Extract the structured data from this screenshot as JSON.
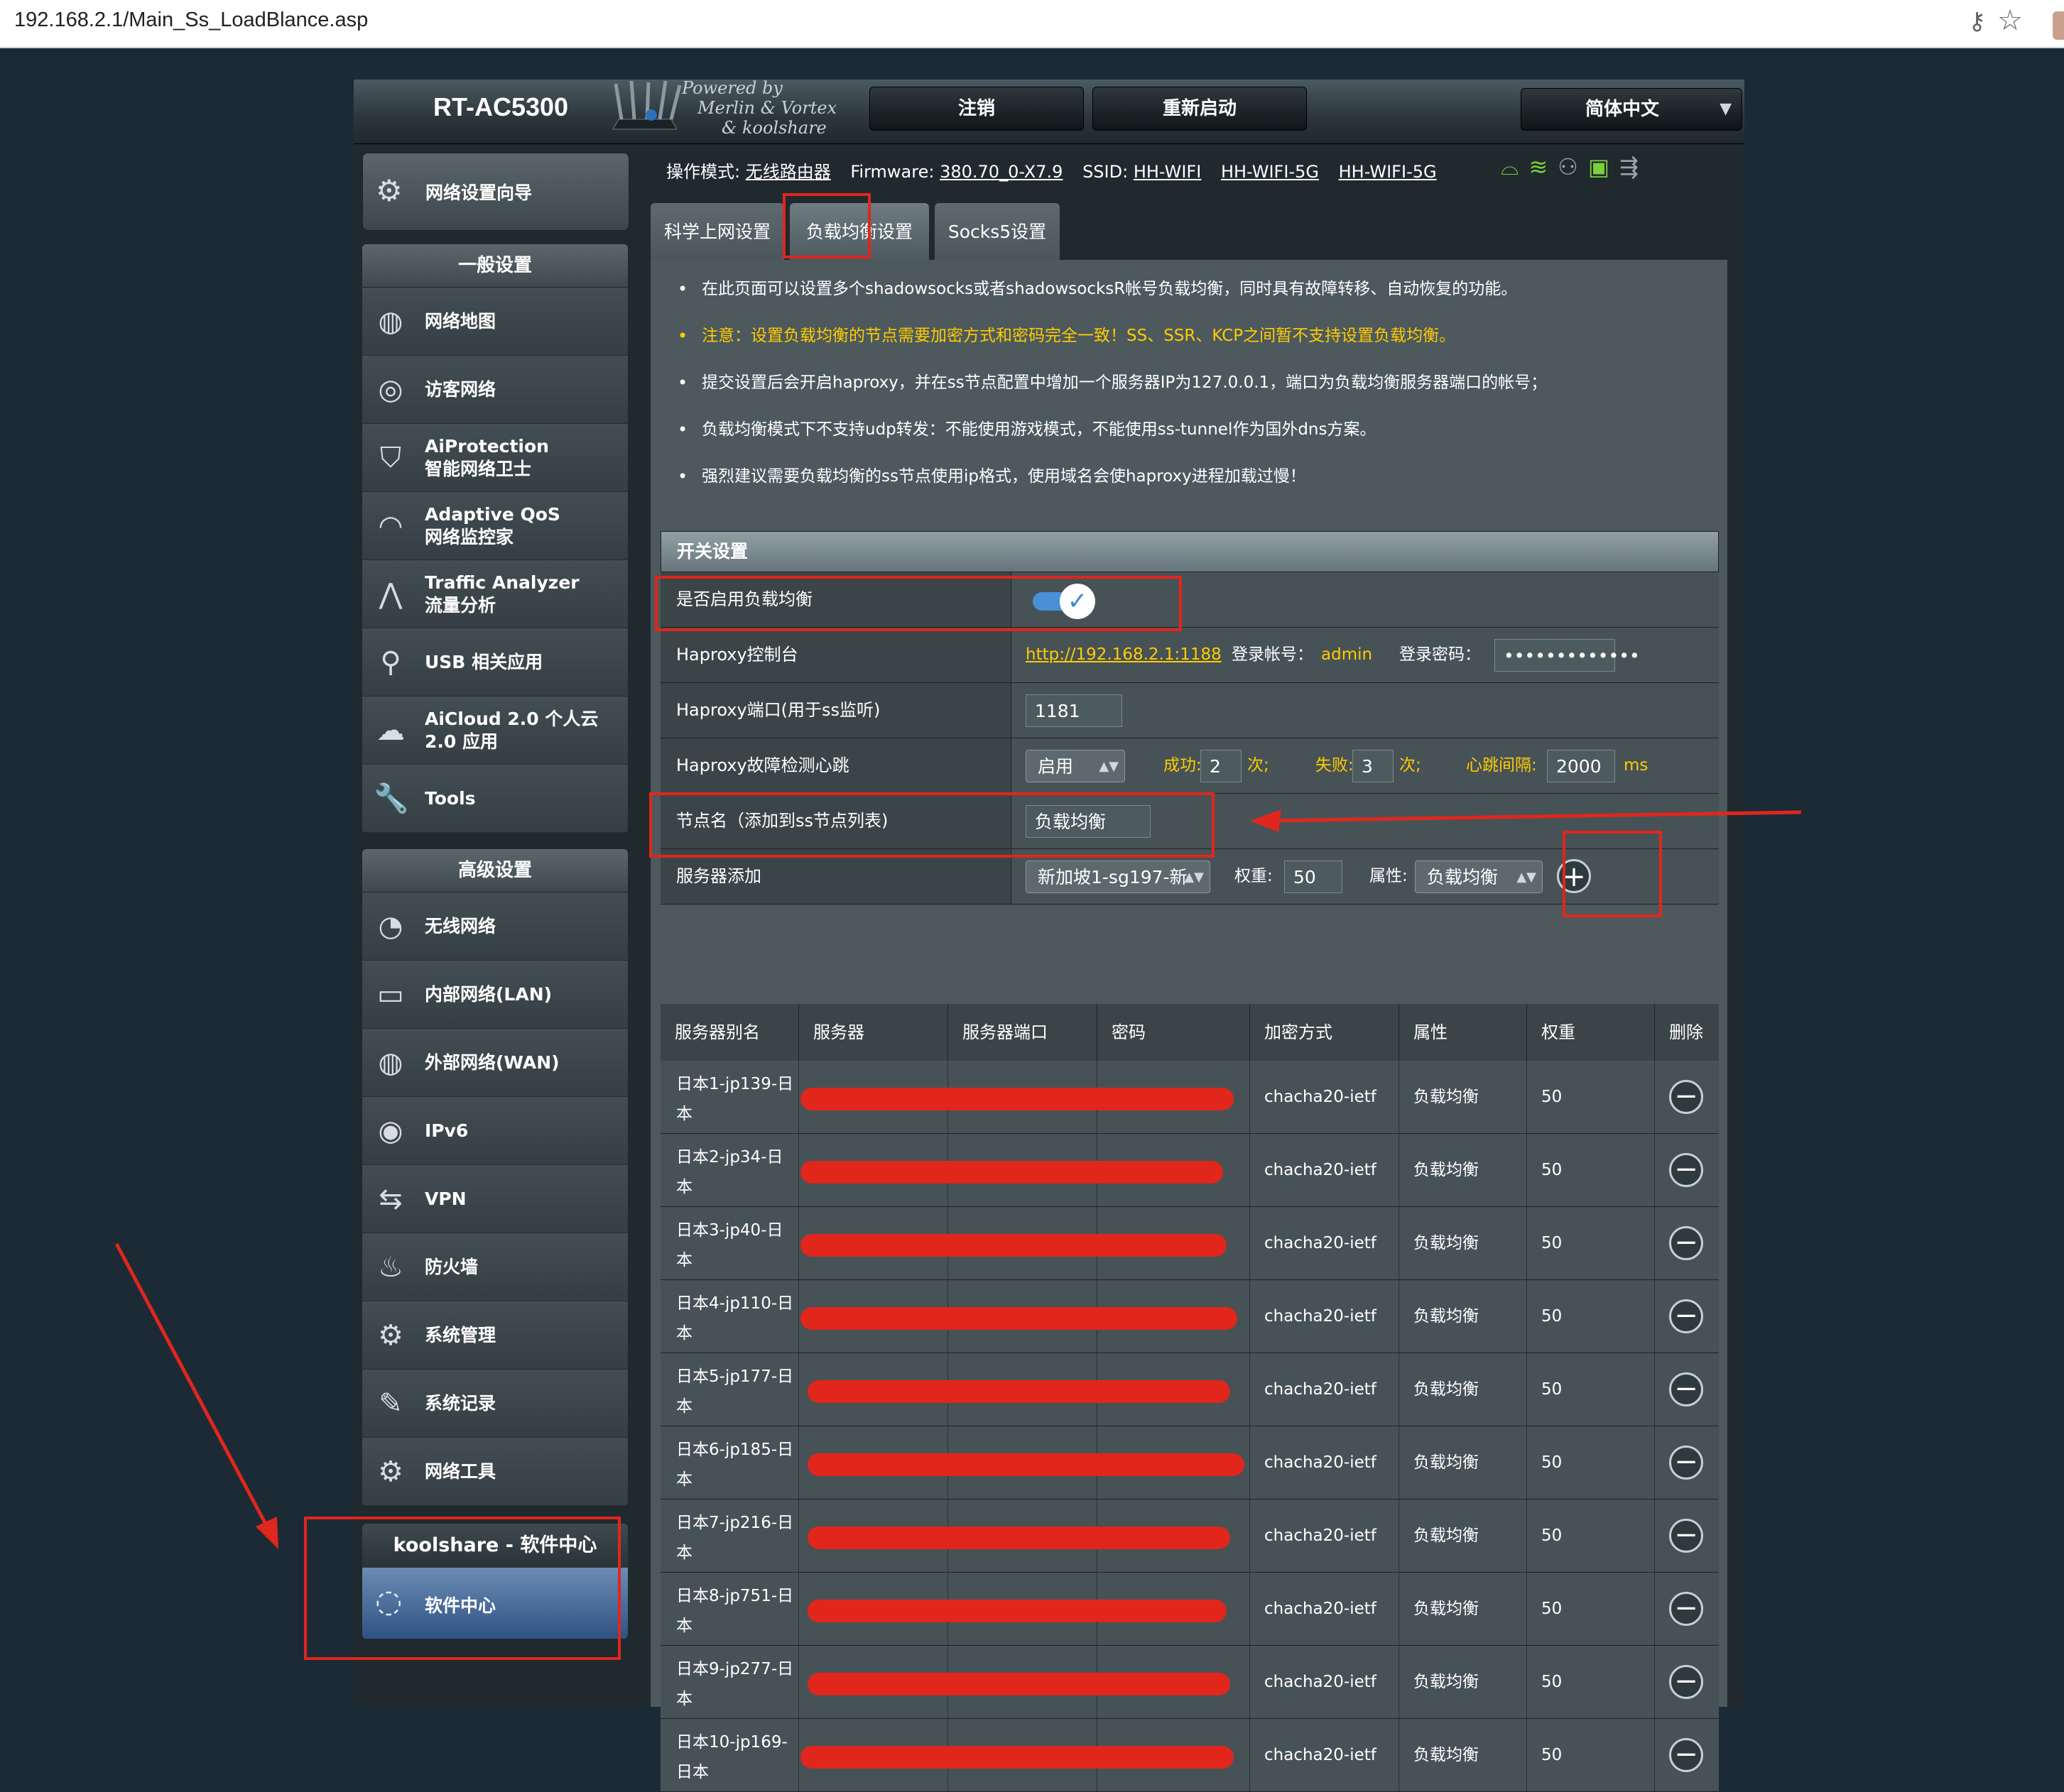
{
  "browser": {
    "url": "192.168.2.1/Main_Ss_LoadBlance.asp",
    "key_icon": "key-icon",
    "bookmark_icon": "star-icon"
  },
  "header": {
    "model": "RT-AC5300",
    "powered": [
      "Powered by",
      "Merlin & Vortex",
      "& koolshare"
    ],
    "logout": "注销",
    "reboot": "重新启动",
    "language": "简体中文"
  },
  "sidebar": {
    "wizard": "网络设置向导",
    "general_title": "一般设置",
    "general": [
      {
        "label": "网络地图",
        "sub": "",
        "icon": "globe-icon"
      },
      {
        "label": "访客网络",
        "sub": "",
        "icon": "guest-network-icon"
      },
      {
        "label": "AiProtection",
        "sub": "智能网络卫士",
        "icon": "shield-icon"
      },
      {
        "label": "Adaptive QoS",
        "sub": "网络监控家",
        "icon": "gauge-icon"
      },
      {
        "label": "Traffic Analyzer",
        "sub": "流量分析",
        "icon": "pulse-icon"
      },
      {
        "label": "USB 相关应用",
        "sub": "",
        "icon": "usb-icon"
      },
      {
        "label": "AiCloud 2.0 个人云",
        "sub": "2.0 应用",
        "icon": "cloud-icon"
      },
      {
        "label": "Tools",
        "sub": "",
        "icon": "wrench-icon"
      }
    ],
    "advanced_title": "高级设置",
    "advanced": [
      {
        "label": "无线网络",
        "sub": "",
        "icon": "wireless-icon"
      },
      {
        "label": "内部网络(LAN)",
        "sub": "",
        "icon": "lan-icon"
      },
      {
        "label": "外部网络(WAN)",
        "sub": "",
        "icon": "wan-globe-icon"
      },
      {
        "label": "IPv6",
        "sub": "",
        "icon": "ipv6-icon"
      },
      {
        "label": "VPN",
        "sub": "",
        "icon": "vpn-icon"
      },
      {
        "label": "防火墙",
        "sub": "",
        "icon": "firewall-icon"
      },
      {
        "label": "系统管理",
        "sub": "",
        "icon": "gear-person-icon"
      },
      {
        "label": "系统记录",
        "sub": "",
        "icon": "log-icon"
      },
      {
        "label": "网络工具",
        "sub": "",
        "icon": "gear-icon"
      }
    ],
    "koolshare_title": "koolshare - 软件中心",
    "koolshare_item": "软件中心"
  },
  "status": {
    "mode_label": "操作模式:",
    "mode_value": "无线路由器",
    "fw_label": "Firmware:",
    "fw_value": "380.70_0-X7.9",
    "ssid_label": "SSID:",
    "ssids": [
      "HH-WIFI",
      "HH-WIFI-5G",
      "HH-WIFI-5G"
    ]
  },
  "tabs": [
    "科学上网设置",
    "负载均衡设置",
    "Socks5设置"
  ],
  "notes": [
    "在此页面可以设置多个shadowsocks或者shadowsocksR帐号负载均衡，同时具有故障转移、自动恢复的功能。",
    "注意：设置负载均衡的节点需要加密方式和密码完全一致！SS、SSR、KCP之间暂不支持设置负载均衡。",
    "提交设置后会开启haproxy，并在ss节点配置中增加一个服务器IP为127.0.0.1，端口为负载均衡服务器端口的帐号；",
    "负载均衡模式下不支持udp转发：不能使用游戏模式，不能使用ss-tunnel作为国外dns方案。",
    "强烈建议需要负载均衡的ss节点使用ip格式，使用域名会使haproxy进程加载过慢！"
  ],
  "switch_section": {
    "title": "开关设置",
    "enable_label": "是否启用负载均衡",
    "enabled": true,
    "console_label": "Haproxy控制台",
    "console_link": "http://192.168.2.1:1188",
    "user_label": "登录帐号：",
    "user_value": "admin",
    "pass_label": "登录密码：",
    "pass_value": "•••••••••••••",
    "port_label": "Haproxy端口(用于ss监听)",
    "port_value": "1181",
    "heartbeat_label": "Haproxy故障检测心跳",
    "heartbeat_select": "启用",
    "success_label": "成功:",
    "success_value": "2",
    "fail_label": "失败:",
    "fail_value": "3",
    "times_unit": "次;",
    "interval_label": "心跳间隔:",
    "interval_value": "2000",
    "interval_unit": "ms",
    "node_label": "节点名（添加到ss节点列表)",
    "node_value": "负载均衡",
    "server_add_label": "服务器添加",
    "server_select": "新加坡1-sg197-新",
    "weight_label": "权重:",
    "weight_value": "50",
    "attr_label": "属性:",
    "attr_select": "负载均衡"
  },
  "server_table": {
    "headers": [
      "服务器别名",
      "服务器",
      "服务器端口",
      "密码",
      "加密方式",
      "属性",
      "权重",
      "删除"
    ],
    "rows": [
      {
        "alias": "日本1-jp139-日本",
        "method": "chacha20-ietf",
        "attr": "负载均衡",
        "weight": "50"
      },
      {
        "alias": "日本2-jp34-日本",
        "method": "chacha20-ietf",
        "attr": "负载均衡",
        "weight": "50"
      },
      {
        "alias": "日本3-jp40-日本",
        "method": "chacha20-ietf",
        "attr": "负载均衡",
        "weight": "50"
      },
      {
        "alias": "日本4-jp110-日本",
        "method": "chacha20-ietf",
        "attr": "负载均衡",
        "weight": "50"
      },
      {
        "alias": "日本5-jp177-日本",
        "method": "chacha20-ietf",
        "attr": "负载均衡",
        "weight": "50"
      },
      {
        "alias": "日本6-jp185-日本",
        "method": "chacha20-ietf",
        "attr": "负载均衡",
        "weight": "50"
      },
      {
        "alias": "日本7-jp216-日本",
        "method": "chacha20-ietf",
        "attr": "负载均衡",
        "weight": "50"
      },
      {
        "alias": "日本8-jp751-日本",
        "method": "chacha20-ietf",
        "attr": "负载均衡",
        "weight": "50"
      },
      {
        "alias": "日本9-jp277-日本",
        "method": "chacha20-ietf",
        "attr": "负载均衡",
        "weight": "50"
      },
      {
        "alias": "日本10-jp169-日本",
        "method": "chacha20-ietf",
        "attr": "负载均衡",
        "weight": "50"
      }
    ]
  },
  "colors": {
    "panel": "#4d595d",
    "warning": "#ffcc00",
    "annotation_red": "#e0261d",
    "toggle_blue": "#4a90d9"
  }
}
